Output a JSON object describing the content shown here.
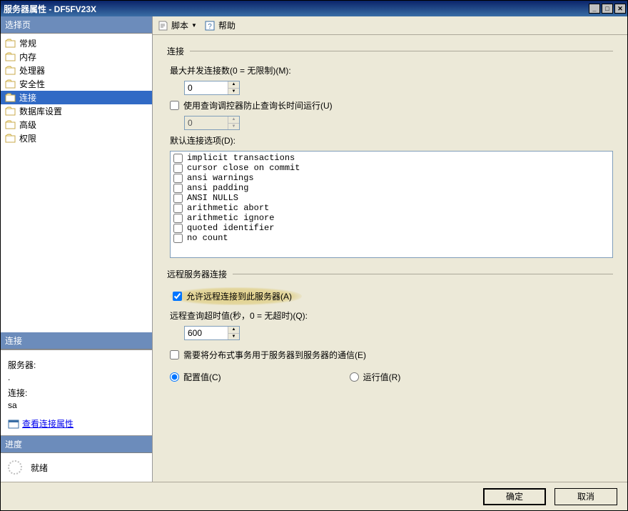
{
  "window": {
    "title": "服务器属性 - DF5FV23X"
  },
  "sidebar": {
    "select_page_label": "选择页",
    "pages": [
      {
        "label": "常规",
        "selected": false
      },
      {
        "label": "内存",
        "selected": false
      },
      {
        "label": "处理器",
        "selected": false
      },
      {
        "label": "安全性",
        "selected": false
      },
      {
        "label": "连接",
        "selected": true
      },
      {
        "label": "数据库设置",
        "selected": false
      },
      {
        "label": "高级",
        "selected": false
      },
      {
        "label": "权限",
        "selected": false
      }
    ],
    "connection_header": "连接",
    "server_label": "服务器:",
    "server_value": ".",
    "connection_label": "连接:",
    "connection_value": "sa",
    "view_props_link": "查看连接属性",
    "progress_header": "进度",
    "progress_status": "就绪"
  },
  "toolbar": {
    "script_label": "脚本",
    "help_label": "帮助"
  },
  "content": {
    "conn_header": "连接",
    "max_conn_label": "最大并发连接数(0 = 无限制)(M):",
    "max_conn_value": "0",
    "use_governor_label": "使用查询调控器防止查询长时间运行(U)",
    "use_governor_checked": false,
    "governor_value": "0",
    "default_opts_label": "默认连接选项(D):",
    "options": [
      "implicit transactions",
      "cursor close on commit",
      "ansi warnings",
      "ansi padding",
      "ANSI NULLS",
      "arithmetic abort",
      "arithmetic ignore",
      "quoted identifier",
      "no count"
    ],
    "remote_header": "远程服务器连接",
    "allow_remote_label": "允许远程连接到此服务器(A)",
    "allow_remote_checked": true,
    "remote_timeout_label": "远程查询超时值(秒，0 = 无超时)(Q):",
    "remote_timeout_value": "600",
    "distributed_label": "需要将分布式事务用于服务器到服务器的通信(E)",
    "distributed_checked": false,
    "radio_config_label": "配置值(C)",
    "radio_run_label": "运行值(R)"
  },
  "footer": {
    "ok_label": "确定",
    "cancel_label": "取消"
  }
}
